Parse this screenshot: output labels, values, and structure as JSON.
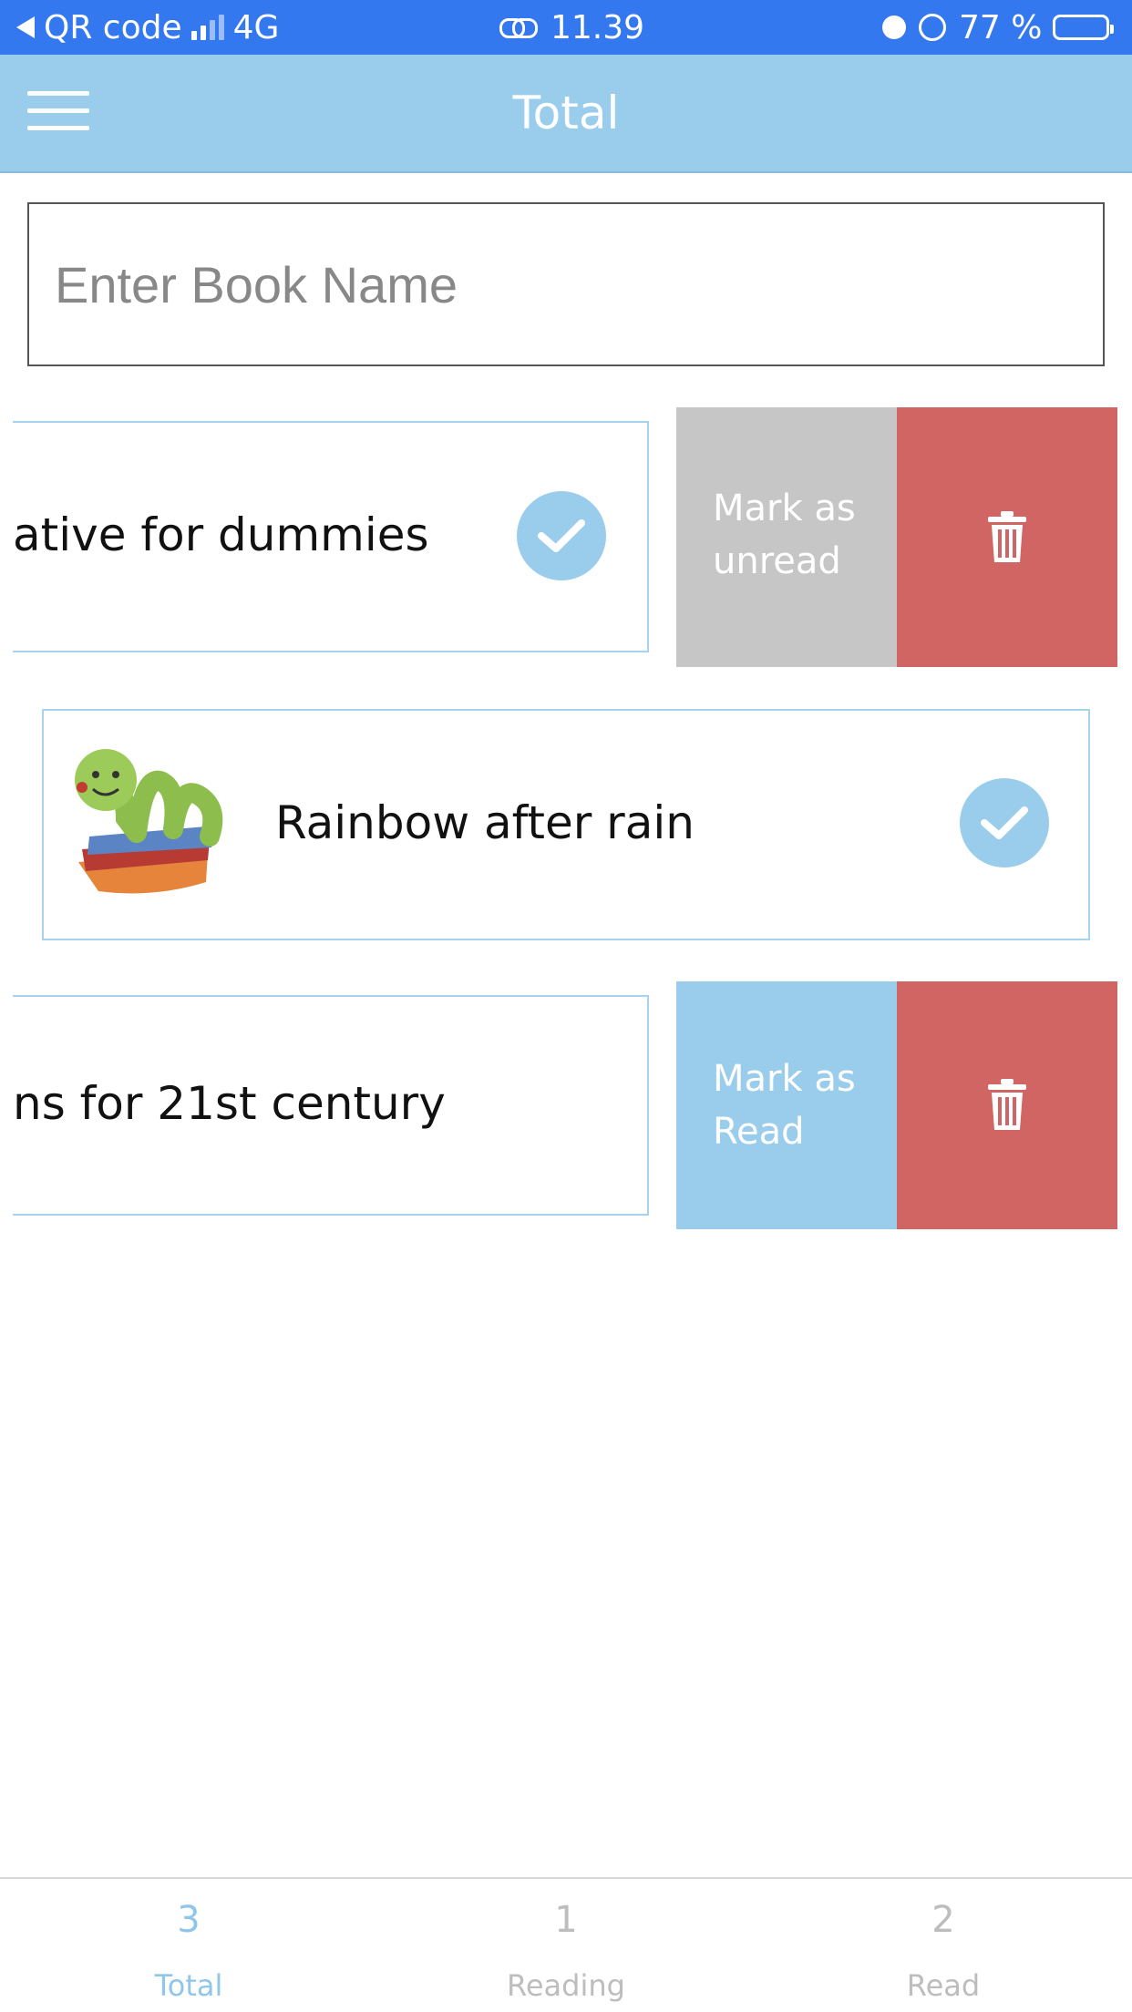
{
  "status_bar": {
    "back_label": "QR code",
    "network": "4G",
    "time": "11.39",
    "battery": "77 %",
    "battery_level": 0.77
  },
  "header": {
    "title": "Total",
    "menu_icon": "hamburger-menu-icon"
  },
  "search": {
    "placeholder": "Enter Book Name",
    "value": ""
  },
  "books": [
    {
      "title": "ative for dummies",
      "read": true,
      "swiped_open": true,
      "actions": {
        "toggle_label": "Mark as unread",
        "delete_icon": "trash-icon"
      }
    },
    {
      "title": "Rainbow after rain",
      "read": true,
      "swiped_open": false,
      "thumbnail_icon": "bookworm-icon"
    },
    {
      "title": "ns for 21st century",
      "read": false,
      "swiped_open": true,
      "actions": {
        "toggle_label": "Mark as Read",
        "delete_icon": "trash-icon"
      }
    }
  ],
  "tabs": [
    {
      "count": "3",
      "label": "Total",
      "active": true
    },
    {
      "count": "1",
      "label": "Reading",
      "active": false
    },
    {
      "count": "2",
      "label": "Read",
      "active": false
    }
  ],
  "colors": {
    "status_bar": "#3478f0",
    "header": "#9acdec",
    "check": "#9acdec",
    "delete": "#d16563",
    "unread_action": "#c6c6c6",
    "read_action": "#9acdec",
    "active_tab": "#8fc6ea"
  }
}
